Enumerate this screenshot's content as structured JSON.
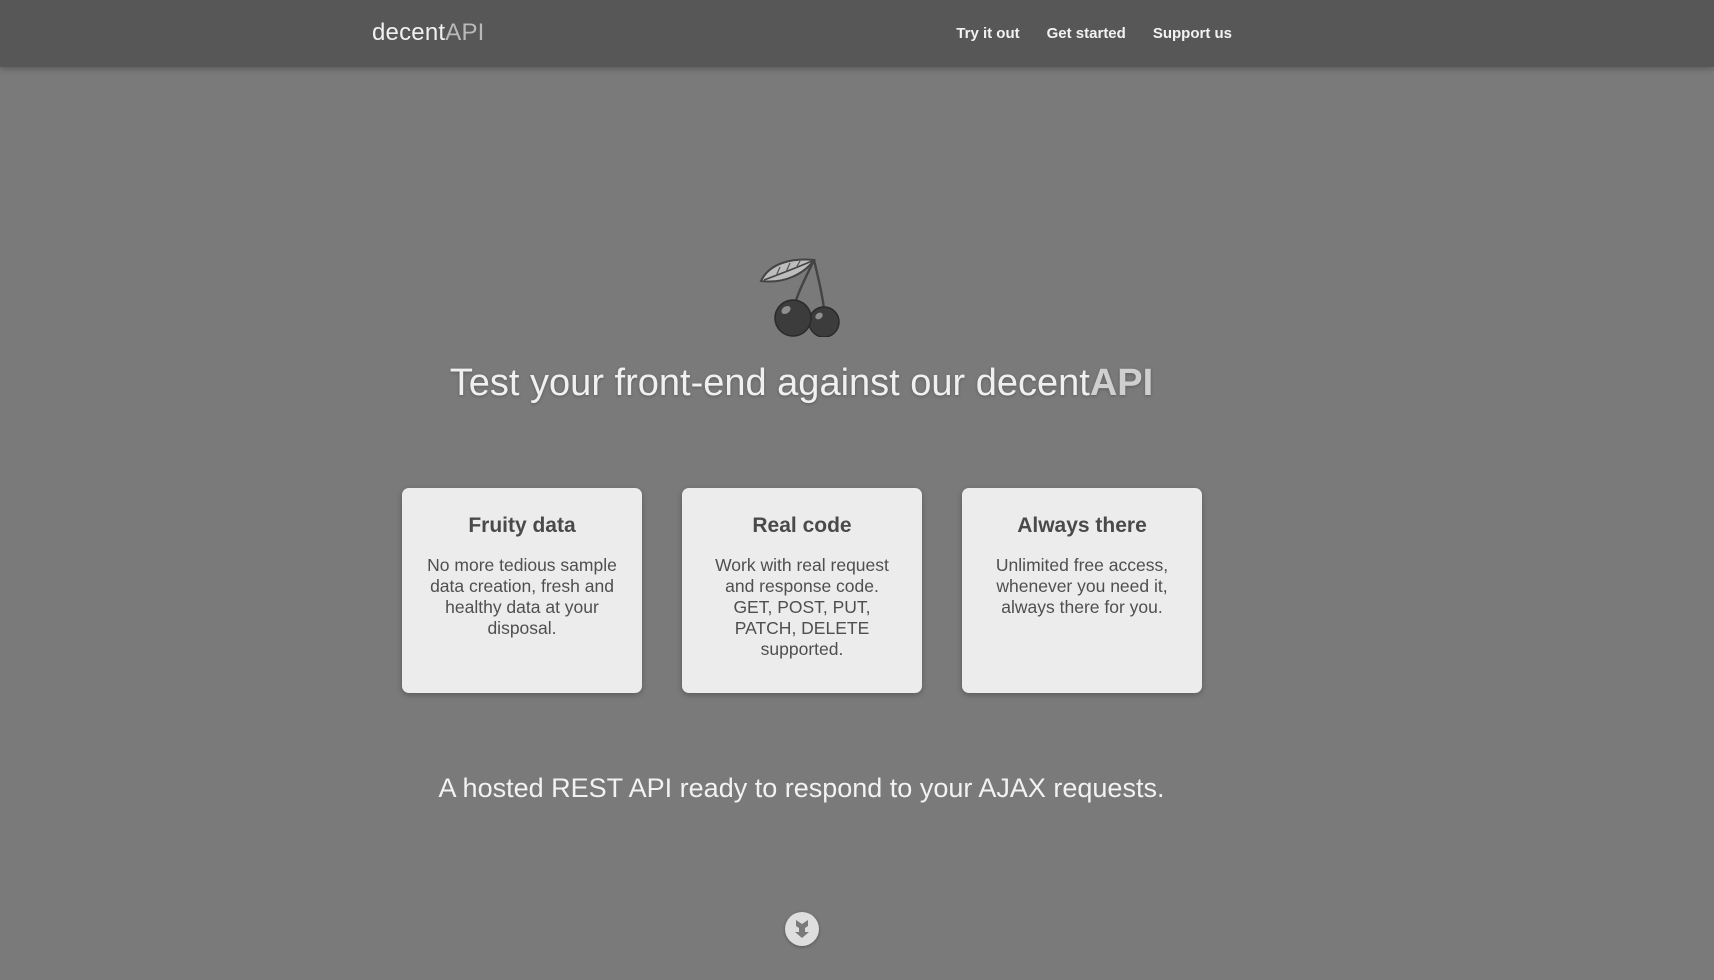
{
  "header": {
    "logo_main": "decent",
    "logo_accent": "API",
    "nav": [
      {
        "label": "Try it out"
      },
      {
        "label": "Get started"
      },
      {
        "label": "Support us"
      }
    ]
  },
  "hero": {
    "icon": "cherry-icon",
    "title_main": "Test your front-end against our decent",
    "title_accent": "API"
  },
  "features": [
    {
      "title": "Fruity data",
      "text": "No more tedious sample data creation, fresh and healthy data at your disposal."
    },
    {
      "title": "Real code",
      "text": "Work with real request and response code. GET, POST, PUT, PATCH, DELETE supported."
    },
    {
      "title": "Always there",
      "text": "Unlimited free access, whenever you need it, always there for you."
    }
  ],
  "tagline": "A hosted REST API ready to respond to your AJAX requests.",
  "scroll_icon": "arrow-down-icon",
  "colors": {
    "background": "#7a7a7a",
    "header": "#575757",
    "card": "#ececec"
  }
}
